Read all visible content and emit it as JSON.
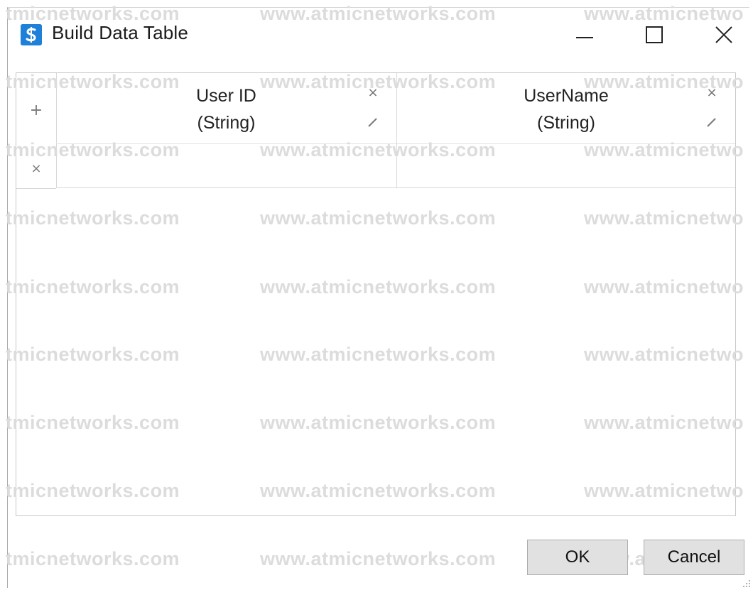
{
  "window": {
    "title": "Build Data Table",
    "app_icon": "studio-s-icon",
    "controls": [
      "minimize-icon",
      "maximize-icon",
      "close-icon"
    ]
  },
  "table": {
    "columns": [
      {
        "name": "User ID",
        "type": "(String)"
      },
      {
        "name": "UserName",
        "type": "(String)"
      }
    ],
    "rows": [
      [
        "",
        ""
      ]
    ],
    "row_icons": {
      "add": "+",
      "delete": "×"
    },
    "column_icons": {
      "remove": "×"
    }
  },
  "buttons": {
    "ok_label": "OK",
    "cancel_label": "Cancel"
  },
  "watermark": {
    "left": "tmicnetworks.com",
    "middle": "www.atmicnetworks.com",
    "right": "www.atmicnetwo"
  },
  "colors": {
    "accent": "#1e80d8",
    "button_face": "#e1e1e1",
    "border": "#c8c8c8"
  }
}
